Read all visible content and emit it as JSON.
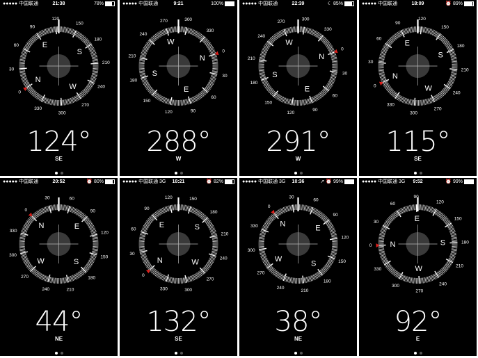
{
  "phones": [
    {
      "carrier": "●●●●● 中国联通",
      "network": "",
      "time": "21:38",
      "icons": "",
      "battery": "78%",
      "batt_level": 0.78,
      "heading": "124°",
      "heading_deg": 124,
      "direction": "SE",
      "target_deg": 0
    },
    {
      "carrier": "●●●●● 中国联通",
      "network": "",
      "time": "9:21",
      "icons": "",
      "battery": "100%",
      "batt_level": 1.0,
      "heading": "288°",
      "heading_deg": 288,
      "direction": "W",
      "target_deg": 0
    },
    {
      "carrier": "●●●●● 中国联通",
      "network": "",
      "time": "22:39",
      "icons": "☾",
      "battery": "85%",
      "batt_level": 0.85,
      "heading": "291°",
      "heading_deg": 291,
      "direction": "W",
      "target_deg": 0
    },
    {
      "carrier": "●●●●● 中国联通",
      "network": "",
      "time": "18:09",
      "icons": "⏰",
      "battery": "89%",
      "batt_level": 0.89,
      "heading": "115°",
      "heading_deg": 115,
      "direction": "SE",
      "target_deg": 0
    },
    {
      "carrier": "●●●●● 中国联通",
      "network": "",
      "time": "20:52",
      "icons": "⏰",
      "battery": "80%",
      "batt_level": 0.8,
      "heading": "44°",
      "heading_deg": 44,
      "direction": "NE",
      "target_deg": 0
    },
    {
      "carrier": "●●●●● 中国联通",
      "network": "3G",
      "time": "18:21",
      "icons": "⏰",
      "battery": "82%",
      "batt_level": 0.82,
      "heading": "132°",
      "heading_deg": 132,
      "direction": "SE",
      "target_deg": 0
    },
    {
      "carrier": "●●●●● 中国联通",
      "network": "3G",
      "time": "10:36",
      "icons": "➚ ⏰",
      "battery": "99%",
      "batt_level": 0.99,
      "heading": "38°",
      "heading_deg": 38,
      "direction": "NE",
      "target_deg": 0
    },
    {
      "carrier": "●●●●● 中国联通",
      "network": "3G",
      "time": "9:52",
      "icons": "⏰",
      "battery": "99%",
      "batt_level": 0.99,
      "heading": "92°",
      "heading_deg": 92,
      "direction": "E",
      "target_deg": 0
    }
  ],
  "dial": {
    "cardinals": [
      "N",
      "E",
      "S",
      "W"
    ],
    "degree_labels": [
      "0",
      "30",
      "60",
      "90",
      "120",
      "150",
      "180",
      "210",
      "240",
      "270",
      "300",
      "330"
    ]
  },
  "colors": {
    "background": "#000000",
    "foreground": "#ffffff",
    "target_marker": "#e0201c",
    "crosshair_disc": "#3a3a3a"
  },
  "page_indicator": {
    "pages": 2,
    "active": 0
  }
}
